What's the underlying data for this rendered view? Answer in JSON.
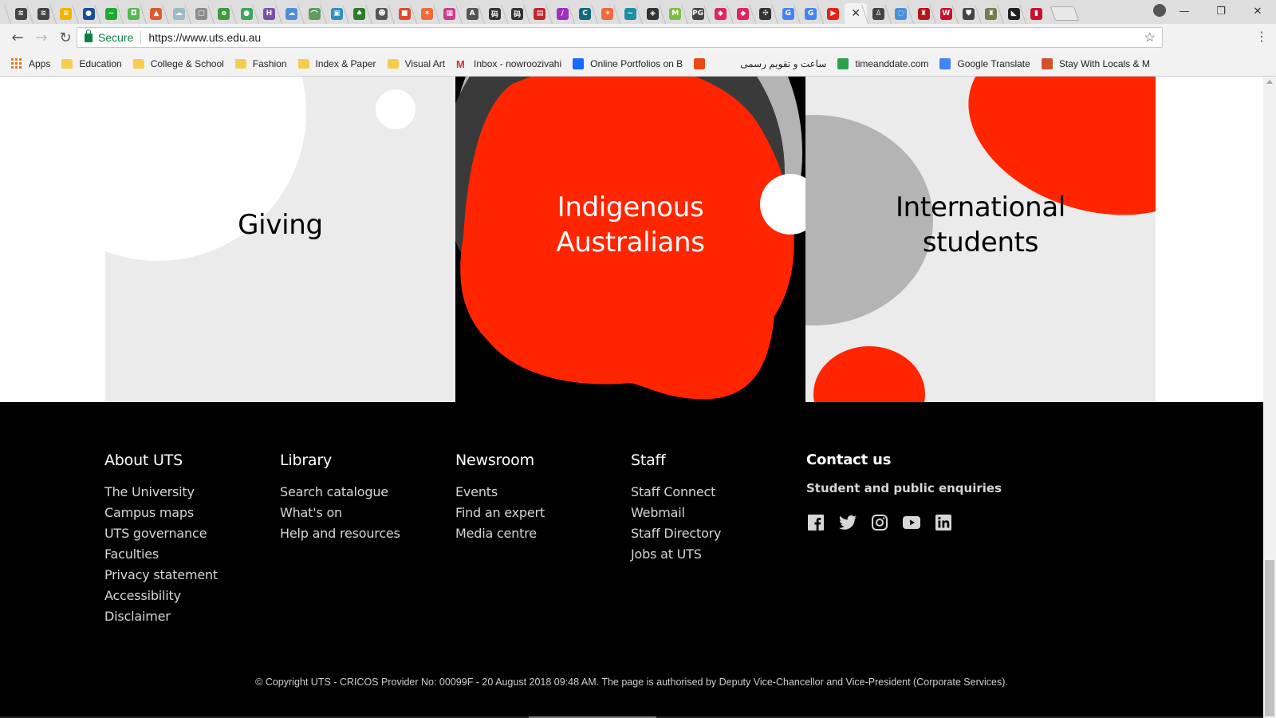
{
  "browser": {
    "tabs": [
      {
        "icon": "lines-icon",
        "color": "#444444",
        "glyph": "≋"
      },
      {
        "icon": "lines-icon",
        "color": "#444444",
        "glyph": "≋"
      },
      {
        "icon": "bookmark-icon",
        "color": "#f1b500",
        "glyph": "≡"
      },
      {
        "icon": "site-icon",
        "color": "#1a4f9c",
        "glyph": "●"
      },
      {
        "icon": "messenger-icon",
        "color": "#1fa834",
        "glyph": "~"
      },
      {
        "icon": "site-icon",
        "color": "#57b84f",
        "glyph": "◘"
      },
      {
        "icon": "google-drive-icon",
        "color": "#e05a2b",
        "glyph": "▲"
      },
      {
        "icon": "cloud-icon",
        "color": "#9fb9c7",
        "glyph": "☁"
      },
      {
        "icon": "page-icon",
        "color": "#8c8c8c",
        "glyph": "▢"
      },
      {
        "icon": "recycle-icon",
        "color": "#3c9b3c",
        "glyph": "e"
      },
      {
        "icon": "globe-icon",
        "color": "#3aa55c",
        "glyph": "●"
      },
      {
        "icon": "letter-h-icon",
        "color": "#7b4fa8",
        "glyph": "H"
      },
      {
        "icon": "cloud-icon",
        "color": "#4a90d9",
        "glyph": "☁"
      },
      {
        "icon": "chart-icon",
        "color": "#5e9e5e",
        "glyph": "⌒"
      },
      {
        "icon": "monitor-icon",
        "color": "#2f8fbf",
        "glyph": "▣"
      },
      {
        "icon": "tree-icon",
        "color": "#2b7d2b",
        "glyph": "♠"
      },
      {
        "icon": "face-icon",
        "color": "#555555",
        "glyph": "☻"
      },
      {
        "icon": "windows-icon",
        "color": "#e04a2b",
        "glyph": "■"
      },
      {
        "icon": "hubspot-icon",
        "color": "#f06a3c",
        "glyph": "✶"
      },
      {
        "icon": "grid-icon",
        "color": "#c93e8b",
        "glyph": "▦"
      },
      {
        "icon": "a-icon",
        "color": "#555555",
        "glyph": "A"
      },
      {
        "icon": "kanji-icon",
        "color": "#333333",
        "glyph": "码"
      },
      {
        "icon": "kanji-icon",
        "color": "#333333",
        "glyph": "码"
      },
      {
        "icon": "form-icon",
        "color": "#c0262e",
        "glyph": "▤"
      },
      {
        "icon": "pen-icon",
        "color": "#a02fbf",
        "glyph": "/"
      },
      {
        "icon": "letter-c-icon",
        "color": "#12697d",
        "glyph": "C"
      },
      {
        "icon": "hubspot-icon",
        "color": "#f06a3c",
        "glyph": "✶"
      },
      {
        "icon": "shark-icon",
        "color": "#1d8fa3",
        "glyph": "~"
      },
      {
        "icon": "owl-icon",
        "color": "#333333",
        "glyph": "◈"
      },
      {
        "icon": "letter-m-icon",
        "color": "#7bc043",
        "glyph": "M"
      },
      {
        "icon": "pg-icon",
        "color": "#444444",
        "glyph": "PG"
      },
      {
        "icon": "book-icon",
        "color": "#e0245e",
        "glyph": "◆"
      },
      {
        "icon": "book-icon",
        "color": "#e0245e",
        "glyph": "◆"
      },
      {
        "icon": "network-icon",
        "color": "#333333",
        "glyph": "✣"
      },
      {
        "icon": "google-icon",
        "color": "#4285f4",
        "glyph": "G"
      },
      {
        "icon": "google-icon",
        "color": "#4285f4",
        "glyph": "G"
      },
      {
        "icon": "youtube-icon",
        "color": "#e62117",
        "glyph": "▶"
      },
      {
        "icon": "close-icon",
        "color": "#333333",
        "glyph": "✕",
        "active": true
      },
      {
        "icon": "figure-icon",
        "color": "#444444",
        "glyph": "♙"
      },
      {
        "icon": "loading-icon",
        "color": "#4a90d9",
        "glyph": "◌"
      },
      {
        "icon": "crest-icon",
        "color": "#b5161c",
        "glyph": "♜"
      },
      {
        "icon": "letter-w-icon",
        "color": "#c8102e",
        "glyph": "W"
      },
      {
        "icon": "shield-icon",
        "color": "#444444",
        "glyph": "⛊"
      },
      {
        "icon": "crest-icon",
        "color": "#7a7a4a",
        "glyph": "♜"
      },
      {
        "icon": "bird-icon",
        "color": "#222222",
        "glyph": "◣"
      },
      {
        "icon": "flag-icon",
        "color": "#c8102e",
        "glyph": "▮"
      }
    ],
    "window_controls": [
      "—",
      "❐",
      "✕"
    ],
    "nav": {
      "back": "←",
      "forward": "→",
      "reload": "↻"
    },
    "security_label": "Secure",
    "url": "https://www.uts.edu.au",
    "bookmarks": [
      {
        "label": "Apps",
        "type": "apps"
      },
      {
        "label": "Education",
        "type": "folder"
      },
      {
        "label": "College & School",
        "type": "folder"
      },
      {
        "label": "Fashion",
        "type": "folder"
      },
      {
        "label": "Index & Paper",
        "type": "folder"
      },
      {
        "label": "Visual Art",
        "type": "folder"
      },
      {
        "label": "Inbox - nowroozivahi",
        "type": "gmail",
        "color": "#d93025"
      },
      {
        "label": "Online Portfolios on B",
        "type": "site",
        "color": "#1769ff"
      },
      {
        "label": "",
        "type": "site",
        "color": "#e84b1a"
      },
      {
        "label": "ساعت و تقویم رسمی",
        "type": "site",
        "color": "#f2f2f2"
      },
      {
        "label": "timeanddate.com",
        "type": "site",
        "color": "#2ba14b"
      },
      {
        "label": "Google Translate",
        "type": "site",
        "color": "#4285f4"
      },
      {
        "label": "Stay With Locals & M",
        "type": "site",
        "color": "#d4502b"
      }
    ]
  },
  "page": {
    "tiles": [
      {
        "title_lines": [
          "Giving"
        ],
        "text_color": "#000000"
      },
      {
        "title_lines": [
          "Indigenous",
          "Australians"
        ],
        "text_color": "#ffffff"
      },
      {
        "title_lines": [
          "International",
          "students"
        ],
        "text_color": "#000000"
      }
    ],
    "colors": {
      "accent_red": "#ff2500",
      "tile_grey": "#ebebeb",
      "shape_grey": "#b4b4b4",
      "dark_grey": "#3a3a3a"
    },
    "footer": {
      "columns": [
        {
          "heading": "About UTS",
          "links": [
            "The University",
            "Campus maps",
            "UTS governance",
            "Faculties",
            "Privacy statement",
            "Accessibility",
            "Disclaimer"
          ]
        },
        {
          "heading": "Library",
          "links": [
            "Search catalogue",
            "What's on",
            "Help and resources"
          ]
        },
        {
          "heading": "Newsroom",
          "links": [
            "Events",
            "Find an expert",
            "Media centre"
          ]
        },
        {
          "heading": "Staff",
          "links": [
            "Staff Connect",
            "Webmail",
            "Staff Directory",
            "Jobs at UTS"
          ]
        }
      ],
      "contact": {
        "heading": "Contact us",
        "subheading": "Student and public enquiries",
        "social": [
          "facebook-icon",
          "twitter-icon",
          "instagram-icon",
          "youtube-icon",
          "linkedin-icon"
        ]
      },
      "copyright": "© Copyright UTS - CRICOS Provider No: 00099F - 20 August 2018 09:48 AM. The page is authorised by Deputy Vice-Chancellor and Vice-President (Corporate Services)."
    }
  }
}
